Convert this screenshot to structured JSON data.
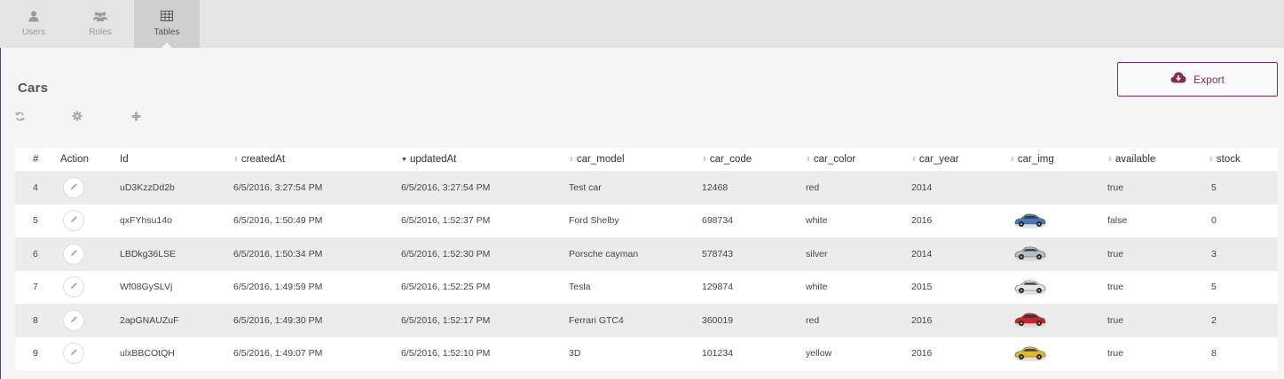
{
  "nav": {
    "items": [
      {
        "label": "Users",
        "icon": "user-icon"
      },
      {
        "label": "Roles",
        "icon": "users-icon"
      },
      {
        "label": "Tables",
        "icon": "table-icon",
        "active": true
      }
    ]
  },
  "page": {
    "title": "Cars"
  },
  "export": {
    "label": "Export",
    "icon": "cloud-download-icon",
    "color": "#8b2a5a"
  },
  "toolbar": {
    "icons": [
      "refresh-icon",
      "gear-icon",
      "plus-icon"
    ]
  },
  "table": {
    "columns": [
      "#",
      "Action",
      "Id",
      "createdAt",
      "updatedAt",
      "car_model",
      "car_code",
      "car_color",
      "car_year",
      "car_img",
      "available",
      "stock"
    ],
    "sorted_column": "updatedAt",
    "rows": [
      {
        "num": "4",
        "id": "uD3KzzDd2b",
        "createdAt": "6/5/2016, 3:27:54 PM",
        "updatedAt": "6/5/2016, 3:27:54 PM",
        "car_model": "Test car",
        "car_code": "12468",
        "car_color": "red",
        "car_year": "2014",
        "car_img": "",
        "available": "true",
        "stock": "5"
      },
      {
        "num": "5",
        "id": "qxFYhsu14o",
        "createdAt": "6/5/2016, 1:50:49 PM",
        "updatedAt": "6/5/2016, 1:52:37 PM",
        "car_model": "Ford Shelby",
        "car_code": "698734",
        "car_color": "white",
        "car_year": "2016",
        "car_img": "#4a78b8",
        "available": "false",
        "stock": "0"
      },
      {
        "num": "6",
        "id": "LBDkg36LSE",
        "createdAt": "6/5/2016, 1:50:34 PM",
        "updatedAt": "6/5/2016, 1:52:30 PM",
        "car_model": "Porsche cayman",
        "car_code": "578743",
        "car_color": "silver",
        "car_year": "2014",
        "car_img": "#b8bcc4",
        "available": "true",
        "stock": "3"
      },
      {
        "num": "7",
        "id": "Wf08GySLVj",
        "createdAt": "6/5/2016, 1:49:59 PM",
        "updatedAt": "6/5/2016, 1:52:25 PM",
        "car_model": "Tesla",
        "car_code": "129874",
        "car_color": "white",
        "car_year": "2015",
        "car_img": "#e8e8e8",
        "available": "true",
        "stock": "5"
      },
      {
        "num": "8",
        "id": "2apGNAUZuF",
        "createdAt": "6/5/2016, 1:49:30 PM",
        "updatedAt": "6/5/2016, 1:52:17 PM",
        "car_model": "Ferrari GTC4",
        "car_code": "360019",
        "car_color": "red",
        "car_year": "2016",
        "car_img": "#d42020",
        "available": "true",
        "stock": "2"
      },
      {
        "num": "9",
        "id": "ulxBBCOtQH",
        "createdAt": "6/5/2016, 1:49:07 PM",
        "updatedAt": "6/5/2016, 1:52:10 PM",
        "car_model": "3D",
        "car_code": "101234",
        "car_color": "yellow",
        "car_year": "2016",
        "car_img": "#e8b820",
        "available": "true",
        "stock": "8"
      }
    ]
  }
}
